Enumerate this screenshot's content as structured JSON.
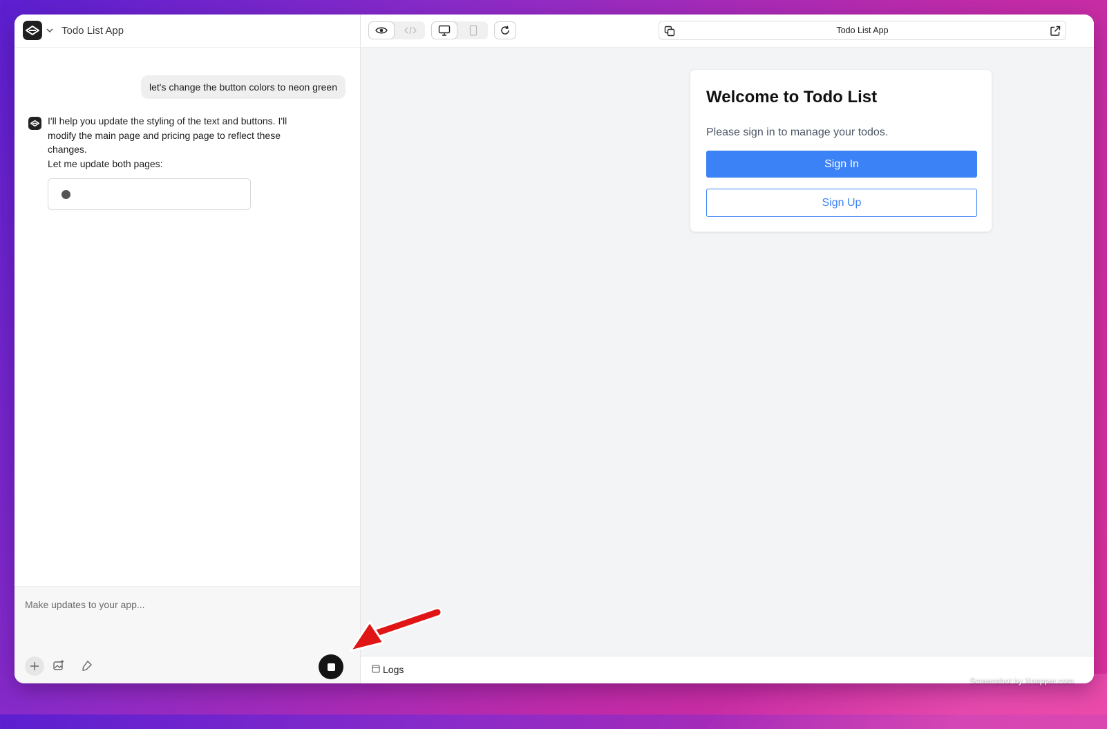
{
  "left_panel": {
    "app_title": "Todo List App",
    "user_message": "let's change the button colors to neon green",
    "assistant_lines": [
      "I'll help you update the styling of the text and buttons. I'll",
      "modify the main page and pricing page to reflect these",
      "changes.",
      "Let me update both pages:"
    ],
    "composer_placeholder": "Make updates to your app..."
  },
  "toolbar": {
    "view_modes": [
      "preview-icon",
      "code-icon"
    ],
    "device_modes": [
      "desktop-icon",
      "mobile-icon"
    ],
    "url_title": "Todo List App"
  },
  "preview": {
    "title": "Welcome to Todo List",
    "subtitle": "Please sign in to manage your todos.",
    "signin_label": "Sign In",
    "signup_label": "Sign Up",
    "primary_color": "#3b82f6"
  },
  "logs": {
    "label": "Logs"
  },
  "watermark": "Screenshot by Xnapper.com"
}
